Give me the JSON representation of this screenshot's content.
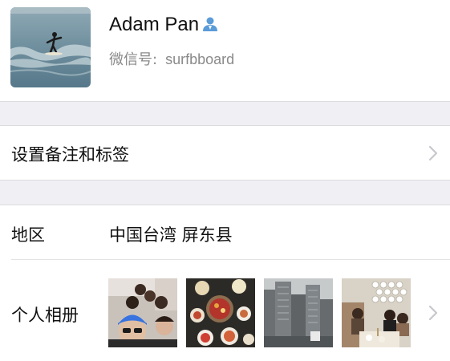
{
  "profile": {
    "name": "Adam Pan",
    "wechat_id_label": "微信号:",
    "wechat_id_value": "surfbboard",
    "avatar_icon": "surfer-photo",
    "contact_icon": "contact-person-icon"
  },
  "remark_row": {
    "label": "设置备注和标签"
  },
  "region_row": {
    "label": "地区",
    "value": "中国台湾 屏东县"
  },
  "album_row": {
    "label": "个人相册",
    "photos": [
      "group-selfie-photo",
      "hotpot-dinner-photo",
      "apartment-buildings-photo",
      "restaurant-group-photo"
    ]
  },
  "colors": {
    "accent_blue": "#5a9bd8",
    "section_gap": "#efeff4",
    "secondary_text": "#8a8a8a",
    "chevron": "#c7c7cc"
  }
}
